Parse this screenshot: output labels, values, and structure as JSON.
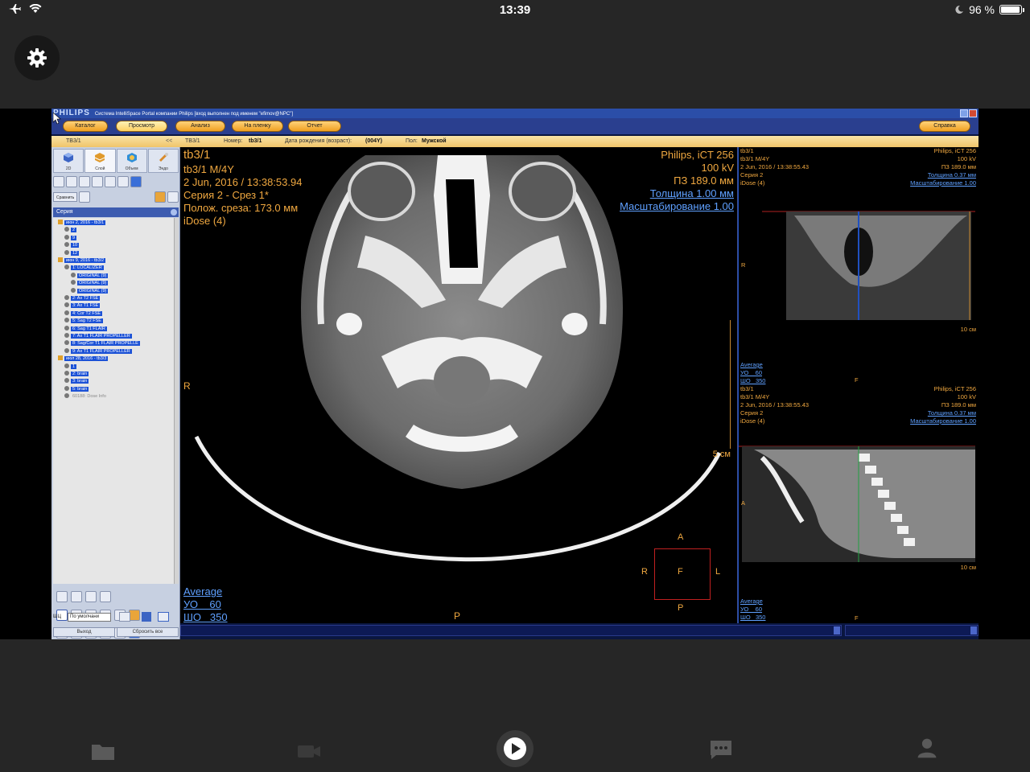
{
  "status": {
    "time": "13:39",
    "battery": "96 %",
    "battery_level": 0.96
  },
  "app": {
    "brand": "PHILIPS",
    "window_title": "Система IntelliSpace Portal компании Philips [вход выполнен под именем \"efimov@NPC\"]",
    "nav": {
      "catalog": "Каталог",
      "view": "Просмотр",
      "analysis": "Анализ",
      "film": "На пленку",
      "report": "Отчет",
      "help": "Справка"
    },
    "patient": {
      "tab_left": "ТВ3/1",
      "collapse": "<<",
      "tab_main": "ТВ3/1",
      "number_label": "Номер:",
      "number_value": "tb3/1",
      "dob_label": "Дата рождения (возраст):",
      "dob_value": "(004Y)",
      "sex_label": "Пол:",
      "sex_value": "Мужской"
    },
    "modes": [
      "2D",
      "Слой",
      "Объем",
      "Эндо"
    ],
    "compare_label": "Сравнить",
    "series_header": "Серия",
    "tree": [
      {
        "text": "июн 2, 2016 - tb3/1",
        "level": 0,
        "kind": "folder"
      },
      {
        "text": "2",
        "level": 1,
        "kind": "item"
      },
      {
        "text": "9",
        "level": 1,
        "kind": "item"
      },
      {
        "text": "10",
        "level": 1,
        "kind": "item"
      },
      {
        "text": "12",
        "level": 1,
        "kind": "item"
      },
      {
        "text": "июн 9, 2016 - tb3/2",
        "level": 0,
        "kind": "folder"
      },
      {
        "text": "1: LOCALIZER",
        "level": 1,
        "kind": "item"
      },
      {
        "text": "ORIGINAL (9)",
        "level": 2,
        "kind": "item"
      },
      {
        "text": "ORIGINAL (9)",
        "level": 2,
        "kind": "item"
      },
      {
        "text": "ORIGINAL (9)",
        "level": 2,
        "kind": "item"
      },
      {
        "text": "2: Ax T2 FSE",
        "level": 1,
        "kind": "item"
      },
      {
        "text": "3: Ax T1 FSE",
        "level": 1,
        "kind": "item"
      },
      {
        "text": "4: Cor T2 FSE",
        "level": 1,
        "kind": "item"
      },
      {
        "text": "5: Sag T2 FSE",
        "level": 1,
        "kind": "item"
      },
      {
        "text": "6: Sag T1 FLAIR",
        "level": 1,
        "kind": "item"
      },
      {
        "text": "7: Ax T1 FLAIR PROPELLER",
        "level": 1,
        "kind": "item"
      },
      {
        "text": "8: Sag/Cor T1 FLAIR PROPELLE",
        "level": 1,
        "kind": "item"
      },
      {
        "text": "9: Ax T1 FLAIR PROPELLER",
        "level": 1,
        "kind": "item"
      },
      {
        "text": "июл 28, 2016 - tb3/3",
        "level": 0,
        "kind": "folder"
      },
      {
        "text": "1",
        "level": 1,
        "kind": "item"
      },
      {
        "text": "2: brain",
        "level": 1,
        "kind": "item"
      },
      {
        "text": "3: brain",
        "level": 1,
        "kind": "item"
      },
      {
        "text": "5: brain",
        "level": 1,
        "kind": "item"
      },
      {
        "text": "60188: Dose Info",
        "level": 1,
        "kind": "plain"
      }
    ],
    "shd_label": "ШЦ",
    "shd_select": "По умолчани",
    "exit_label": "Выход",
    "reset_label": "Сбросить все",
    "main_overlay": {
      "tl": [
        "tb3/1",
        "tb3/1 M/4Y",
        "2 Jun, 2016 / 13:38:53.94",
        "Серия 2 - Срез 1*",
        "Полож. среза: 173.0 мм",
        "iDose (4)"
      ],
      "tr": [
        "Philips, iCT 256",
        "100 kV",
        "ПЗ 189.0 мм"
      ],
      "tr_links": [
        "Толщина 1.00 мм",
        "Масштабирование 1.00"
      ],
      "bl": [
        "Average",
        "УО    60",
        "ШО   350"
      ],
      "scale": "5 см",
      "orient_left": "R",
      "orient_bottom": "P",
      "box_a": "A",
      "box_r": "R",
      "box_f": "F",
      "box_l": "L",
      "box_p": "P"
    },
    "sub1": {
      "tl": [
        "tb3/1",
        "tb3/1 M/4Y",
        "2 Jun, 2016 / 13:38:55.43",
        "Серия 2",
        "iDose (4)"
      ],
      "tr": [
        "Philips, iCT 256",
        "100 kV",
        "ПЗ 189.0 мм"
      ],
      "tr_links": [
        "Толщина 0.37 мм",
        "Масштабирование 1.00"
      ],
      "orient_left": "R",
      "orient_bottom": "F",
      "scale": "10 см",
      "bl": [
        "Average",
        "УО    60",
        "ШО   350"
      ]
    },
    "sub2": {
      "tl": [
        "tb3/1",
        "tb3/1 M/4Y",
        "2 Jun, 2016 / 13:38:55.43",
        "Серия 2",
        "iDose (4)"
      ],
      "tr": [
        "Philips, iCT 256",
        "100 kV",
        "ПЗ 189.0 мм"
      ],
      "tr_links": [
        "Толщина 0.37 мм",
        "Масштабирование 1.00"
      ],
      "orient_left": "A",
      "orient_bottom": "F",
      "scale": "10 см",
      "bl": [
        "Average",
        "УО    60",
        "ШО   350"
      ]
    }
  },
  "colors": {
    "overlay": "#f0a840",
    "link": "#5fa0ff",
    "nav_orange": "#f0a020",
    "tree_select": "#1b51d6"
  },
  "icons": [
    "airplane-icon",
    "wifi-icon",
    "moon-icon",
    "battery-icon",
    "gear-icon",
    "folder-icon",
    "video-icon",
    "play-icon",
    "chat-icon",
    "person-icon"
  ]
}
